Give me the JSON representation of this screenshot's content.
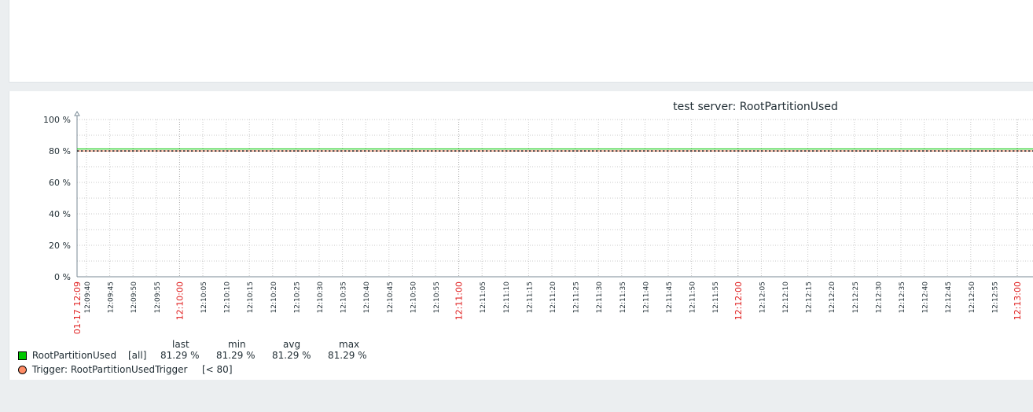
{
  "chart_data": {
    "type": "line",
    "title": "test server: RootPartitionUsed",
    "ylim": [
      0,
      100
    ],
    "y_ticks": [
      "100 %",
      "80 %",
      "60 %",
      "40 %",
      "20 %",
      "0 %"
    ],
    "x_ticks": [
      {
        "label": "01-17 12:09",
        "major": true
      },
      {
        "label": "12:09:40",
        "major": false
      },
      {
        "label": "12:09:45",
        "major": false
      },
      {
        "label": "12:09:50",
        "major": false
      },
      {
        "label": "12:09:55",
        "major": false
      },
      {
        "label": "12:10:00",
        "major": true
      },
      {
        "label": "12:10:05",
        "major": false
      },
      {
        "label": "12:10:10",
        "major": false
      },
      {
        "label": "12:10:15",
        "major": false
      },
      {
        "label": "12:10:20",
        "major": false
      },
      {
        "label": "12:10:25",
        "major": false
      },
      {
        "label": "12:10:30",
        "major": false
      },
      {
        "label": "12:10:35",
        "major": false
      },
      {
        "label": "12:10:40",
        "major": false
      },
      {
        "label": "12:10:45",
        "major": false
      },
      {
        "label": "12:10:50",
        "major": false
      },
      {
        "label": "12:10:55",
        "major": false
      },
      {
        "label": "12:11:00",
        "major": true
      },
      {
        "label": "12:11:05",
        "major": false
      },
      {
        "label": "12:11:10",
        "major": false
      },
      {
        "label": "12:11:15",
        "major": false
      },
      {
        "label": "12:11:20",
        "major": false
      },
      {
        "label": "12:11:25",
        "major": false
      },
      {
        "label": "12:11:30",
        "major": false
      },
      {
        "label": "12:11:35",
        "major": false
      },
      {
        "label": "12:11:40",
        "major": false
      },
      {
        "label": "12:11:45",
        "major": false
      },
      {
        "label": "12:11:50",
        "major": false
      },
      {
        "label": "12:11:55",
        "major": false
      },
      {
        "label": "12:12:00",
        "major": true
      },
      {
        "label": "12:12:05",
        "major": false
      },
      {
        "label": "12:12:10",
        "major": false
      },
      {
        "label": "12:12:15",
        "major": false
      },
      {
        "label": "12:12:20",
        "major": false
      },
      {
        "label": "12:12:25",
        "major": false
      },
      {
        "label": "12:12:30",
        "major": false
      },
      {
        "label": "12:12:35",
        "major": false
      },
      {
        "label": "12:12:40",
        "major": false
      },
      {
        "label": "12:12:45",
        "major": false
      },
      {
        "label": "12:12:50",
        "major": false
      },
      {
        "label": "12:12:55",
        "major": false
      },
      {
        "label": "12:13:00",
        "major": true
      }
    ],
    "series": [
      {
        "name": "RootPartitionUsed",
        "color": "#00c800",
        "value": 81.29,
        "last": "81.29 %",
        "min": "81.29 %",
        "avg": "81.29 %",
        "max": "81.29 %",
        "func": "[all]"
      }
    ],
    "trigger": {
      "label": "Trigger: RootPartitionUsedTrigger",
      "condition": "[< 80]",
      "value": 80,
      "color": "#ff8c66"
    },
    "legend_headers": {
      "last": "last",
      "min": "min",
      "avg": "avg",
      "max": "max"
    },
    "grid": true,
    "colors": {
      "axis": "#607080",
      "grid": "#c8c8c8",
      "major_tick": "#e02020",
      "tick": "#1f2c33"
    }
  }
}
